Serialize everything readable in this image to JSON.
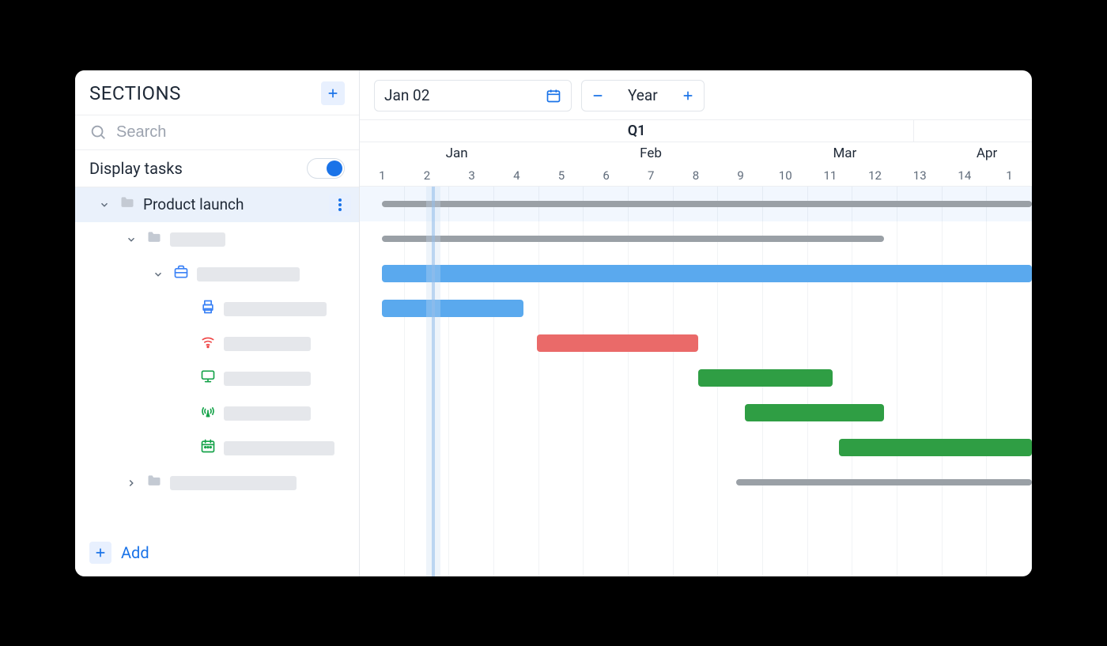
{
  "sidebar": {
    "title": "SECTIONS",
    "search_placeholder": "Search",
    "display_tasks_label": "Display tasks",
    "display_tasks_on": true,
    "add_label": "Add",
    "nodes": [
      {
        "level": 0,
        "expand": "down",
        "icon": "folder",
        "icon_color": "#c4cad3",
        "label": "Product launch",
        "selected": true,
        "actions": true
      },
      {
        "level": 1,
        "expand": "down",
        "icon": "folder",
        "icon_color": "#c4cad3",
        "placeholder_w": 70
      },
      {
        "level": 2,
        "expand": "down",
        "icon": "briefcase",
        "icon_color": "#3b82f6",
        "placeholder_w": 130
      },
      {
        "level": 3,
        "expand": "none",
        "icon": "printer",
        "icon_color": "#3b82f6",
        "placeholder_w": 130
      },
      {
        "level": 3,
        "expand": "none",
        "icon": "wifi",
        "icon_color": "#ef4444",
        "placeholder_w": 110
      },
      {
        "level": 3,
        "expand": "none",
        "icon": "monitor",
        "icon_color": "#16a34a",
        "placeholder_w": 110
      },
      {
        "level": 3,
        "expand": "none",
        "icon": "antenna",
        "icon_color": "#16a34a",
        "placeholder_w": 110
      },
      {
        "level": 3,
        "expand": "none",
        "icon": "calendar",
        "icon_color": "#16a34a",
        "placeholder_w": 140
      },
      {
        "level": 1,
        "expand": "right",
        "icon": "folder",
        "icon_color": "#c4cad3",
        "placeholder_w": 160
      }
    ]
  },
  "toolbar": {
    "date_label": "Jan 02",
    "zoom_label": "Year"
  },
  "timeline": {
    "quarter": "Q1",
    "months": [
      "Jan",
      "Feb",
      "Mar",
      "Apr"
    ],
    "weeks": [
      "1",
      "2",
      "3",
      "4",
      "5",
      "6",
      "7",
      "8",
      "9",
      "10",
      "11",
      "12",
      "13",
      "14",
      "1"
    ],
    "total_units": 15,
    "today_unit": 1.6
  },
  "gantt": {
    "rows": [
      {
        "highlight": true,
        "bars": [
          {
            "type": "summary",
            "start": 0.5,
            "end": 15,
            "color": "#9aa0a6"
          }
        ]
      },
      {
        "bars": [
          {
            "type": "summary",
            "start": 0.5,
            "end": 11.7,
            "color": "#9aa0a6"
          }
        ]
      },
      {
        "bars": [
          {
            "type": "task",
            "start": 0.5,
            "end": 15,
            "color": "#5aa9ee"
          }
        ]
      },
      {
        "bars": [
          {
            "type": "task",
            "start": 0.5,
            "end": 3.65,
            "color": "#5aa9ee"
          }
        ]
      },
      {
        "bars": [
          {
            "type": "task",
            "start": 3.95,
            "end": 7.55,
            "color": "#ea6a69"
          }
        ]
      },
      {
        "bars": [
          {
            "type": "task",
            "start": 7.55,
            "end": 10.55,
            "color": "#2f9e44"
          }
        ]
      },
      {
        "bars": [
          {
            "type": "task",
            "start": 8.6,
            "end": 11.7,
            "color": "#2f9e44"
          }
        ]
      },
      {
        "bars": [
          {
            "type": "task",
            "start": 10.7,
            "end": 15,
            "color": "#2f9e44"
          }
        ]
      },
      {
        "bars": [
          {
            "type": "summary",
            "start": 8.4,
            "end": 15,
            "color": "#9aa0a6"
          }
        ]
      },
      {
        "bars": []
      }
    ]
  },
  "colors": {
    "accent": "#1a73e8"
  }
}
